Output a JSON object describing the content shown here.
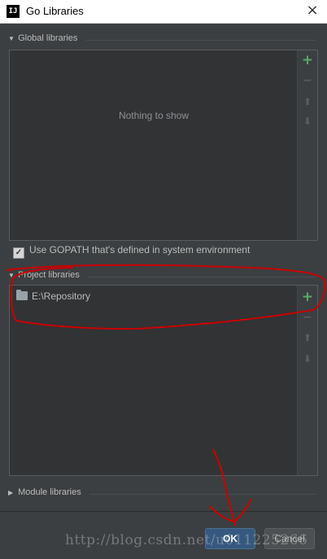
{
  "window": {
    "app_icon_text": "IJ",
    "title": "Go Libraries",
    "close_icon": "×"
  },
  "global_libraries": {
    "header": "Global libraries",
    "empty_text": "Nothing to show",
    "toolbar": {
      "add_icon": "+",
      "remove_icon": "−",
      "up_icon": "⬆",
      "down_icon": "⬇"
    }
  },
  "gopath": {
    "checked": true,
    "checkmark": "✓",
    "label": "Use GOPATH that's defined in system environment"
  },
  "project_libraries": {
    "header": "Project libraries",
    "items": [
      {
        "path": "E:\\Repository"
      }
    ],
    "toolbar": {
      "add_icon": "+",
      "remove_icon": "−",
      "up_icon": "⬆",
      "down_icon": "⬇"
    }
  },
  "module_libraries": {
    "header": "Module libraries"
  },
  "buttons": {
    "ok": "OK",
    "cancel": "Cancel"
  },
  "watermark": "http://blog.csdn.net/u011225266",
  "colors": {
    "background": "#3c3f41",
    "panel": "#313335",
    "add_green": "#59a869",
    "ok_blue": "#365880",
    "annotation_red": "#cc0000"
  }
}
